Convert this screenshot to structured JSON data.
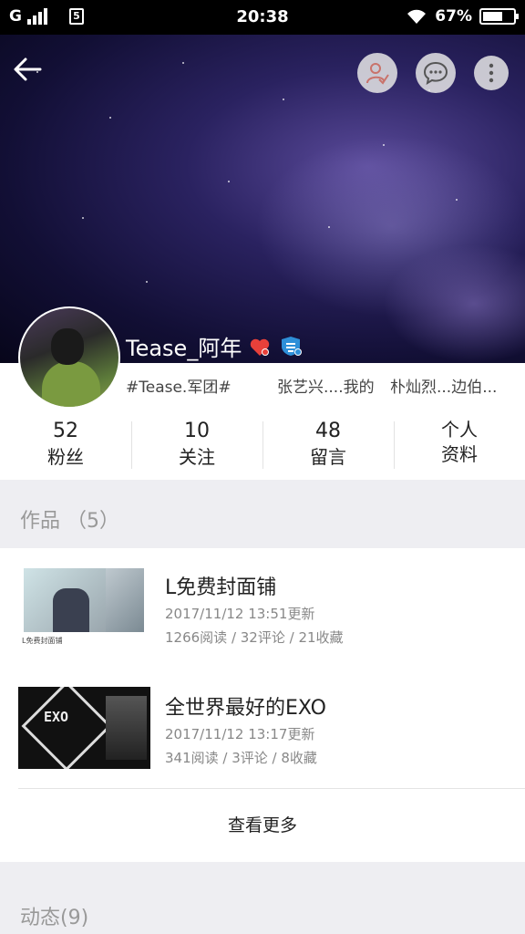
{
  "status": {
    "carrier": "G",
    "sim_icon": "5",
    "time": "20:38",
    "battery": "67%",
    "battery_level": 0.67
  },
  "header": {
    "back_icon": "arrow-left-icon",
    "actions": [
      "follow-user-icon",
      "chat-bubble-icon",
      "more-vertical-icon"
    ]
  },
  "profile": {
    "username": "Tease_阿年",
    "tags": [
      "#Tease.军团#",
      "张艺兴....我的",
      "朴灿烈...边伯..."
    ]
  },
  "stats": [
    {
      "num": "52",
      "label": "粉丝"
    },
    {
      "num": "10",
      "label": "关注"
    },
    {
      "num": "48",
      "label": "留言"
    },
    {
      "line1": "个人",
      "line2": "资料"
    }
  ],
  "works": {
    "section_title": "作品 （5）",
    "items": [
      {
        "title": "L免费封面铺",
        "updated": "2017/11/12 13:51更新",
        "stats": "1266阅读 / 32评论 / 21收藏",
        "thumb_caption": "L免费封面铺"
      },
      {
        "title": "全世界最好的EXO",
        "updated": "2017/11/12 13:17更新",
        "stats": "341阅读 / 3评论 / 8收藏",
        "thumb_text": "EXO"
      }
    ],
    "more_label": "查看更多"
  },
  "activity": {
    "section_title": "动态(9)"
  }
}
